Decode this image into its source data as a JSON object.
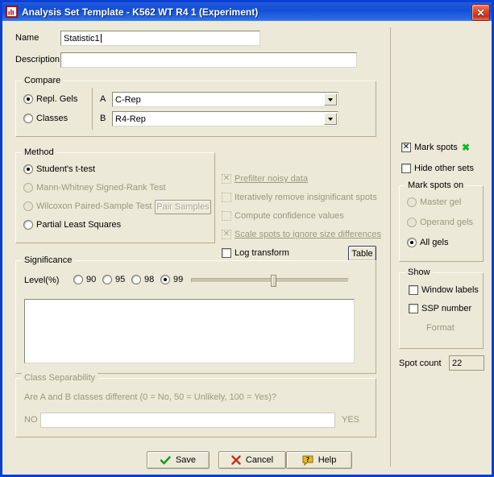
{
  "window": {
    "title": "Analysis Set Template - K562 WT R4 1 (Experiment)",
    "icon": "chart-app-icon",
    "close_label": "✕",
    "accent_color": "#1450d6",
    "face_color": "#ece9d8"
  },
  "form": {
    "name_label": "Name",
    "name_value": "Statistic1",
    "description_label": "Description",
    "description_value": ""
  },
  "compare": {
    "title": "Compare",
    "mode_options": [
      {
        "label": "Repl. Gels",
        "selected": true
      },
      {
        "label": "Classes",
        "selected": false
      }
    ],
    "a_label": "A",
    "a_value": "C-Rep",
    "b_label": "B",
    "b_value": "R4-Rep"
  },
  "method": {
    "title": "Method",
    "options": [
      {
        "label": "Student's t-test",
        "selected": true,
        "disabled": false
      },
      {
        "label": "Mann-Whitney Signed-Rank Test",
        "selected": false,
        "disabled": true
      },
      {
        "label": "Wilcoxon Paired-Sample Test",
        "selected": false,
        "disabled": true
      },
      {
        "label": "Partial Least Squares",
        "selected": false,
        "disabled": false
      }
    ],
    "pair_samples_label": "Pair Samples"
  },
  "options": {
    "checkboxes": [
      {
        "label": "Prefilter noisy data",
        "checked": true,
        "disabled": true,
        "underline": true
      },
      {
        "label": "Iteratively remove insignificant spots",
        "checked": false,
        "disabled": true,
        "underline": false
      },
      {
        "label": "Compute confidence values",
        "checked": false,
        "disabled": true,
        "underline": false
      },
      {
        "label": "Scale spots to ignore size differences",
        "checked": true,
        "disabled": true,
        "underline": true
      },
      {
        "label": "Log transform",
        "checked": false,
        "disabled": false,
        "underline": false
      }
    ],
    "table_button_label": "Table"
  },
  "significance": {
    "title": "Significance",
    "level_label": "Level(%)",
    "levels": [
      {
        "label": "90",
        "selected": false
      },
      {
        "label": "95",
        "selected": false
      },
      {
        "label": "98",
        "selected": false
      },
      {
        "label": "99",
        "selected": true
      }
    ],
    "slider_percent": 52,
    "results_text": ""
  },
  "separability": {
    "title": "Class Separability",
    "question": "Are A and B classes different (0 = No, 50 = Unlikely, 100 = Yes)?",
    "min_label": "NO",
    "max_label": "YES",
    "value_percent": 0
  },
  "right_panel": {
    "mark_spots": {
      "label": "Mark spots",
      "checked": true,
      "marker_glyph": "✖",
      "marker_color": "#13b521"
    },
    "hide_other_sets": {
      "label": "Hide other sets",
      "checked": false
    },
    "mark_spots_on": {
      "title": "Mark spots on",
      "options": [
        {
          "label": "Master gel",
          "selected": false,
          "disabled": true
        },
        {
          "label": "Operand gels",
          "selected": false,
          "disabled": true
        },
        {
          "label": "All gels",
          "selected": true,
          "disabled": false
        }
      ]
    },
    "show": {
      "title": "Show",
      "checkboxes": [
        {
          "label": "Window labels",
          "checked": false
        },
        {
          "label": "SSP number",
          "checked": false
        }
      ],
      "format_button_label": "Format"
    },
    "spot_count_label": "Spot count",
    "spot_count_value": "22"
  },
  "footer": {
    "save_label": "Save",
    "cancel_label": "Cancel",
    "help_label": "Help"
  }
}
